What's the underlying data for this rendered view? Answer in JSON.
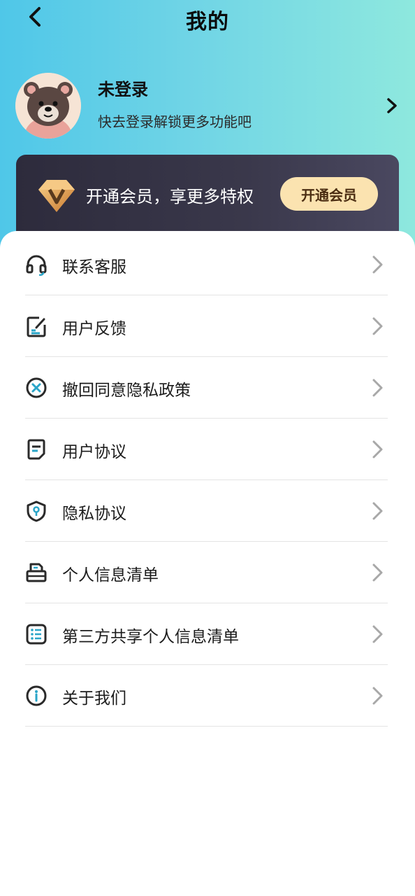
{
  "header": {
    "title": "我的",
    "back_icon": "chevron-left-icon"
  },
  "profile": {
    "name": "未登录",
    "subtitle": "快去登录解锁更多功能吧",
    "avatar_icon": "bear-avatar",
    "arrow_icon": "chevron-right-icon"
  },
  "vip": {
    "text": "开通会员，享更多特权",
    "button_label": "开通会员",
    "icon": "diamond-v-icon"
  },
  "menu": {
    "items": [
      {
        "label": "联系客服",
        "icon": "headset-icon"
      },
      {
        "label": "用户反馈",
        "icon": "edit-note-icon"
      },
      {
        "label": "撤回同意隐私政策",
        "icon": "close-circle-icon"
      },
      {
        "label": "用户协议",
        "icon": "document-icon"
      },
      {
        "label": "隐私协议",
        "icon": "shield-icon"
      },
      {
        "label": "个人信息清单",
        "icon": "printer-icon"
      },
      {
        "label": "第三方共享个人信息清单",
        "icon": "list-icon"
      },
      {
        "label": "关于我们",
        "icon": "info-icon"
      }
    ]
  },
  "colors": {
    "header_gradient_start": "#4fc7e8",
    "header_gradient_end": "#8ee8de",
    "vip_card": "#2d2b3c",
    "vip_button": "#fbe3b0",
    "icon_accent": "#2aa5c8"
  }
}
